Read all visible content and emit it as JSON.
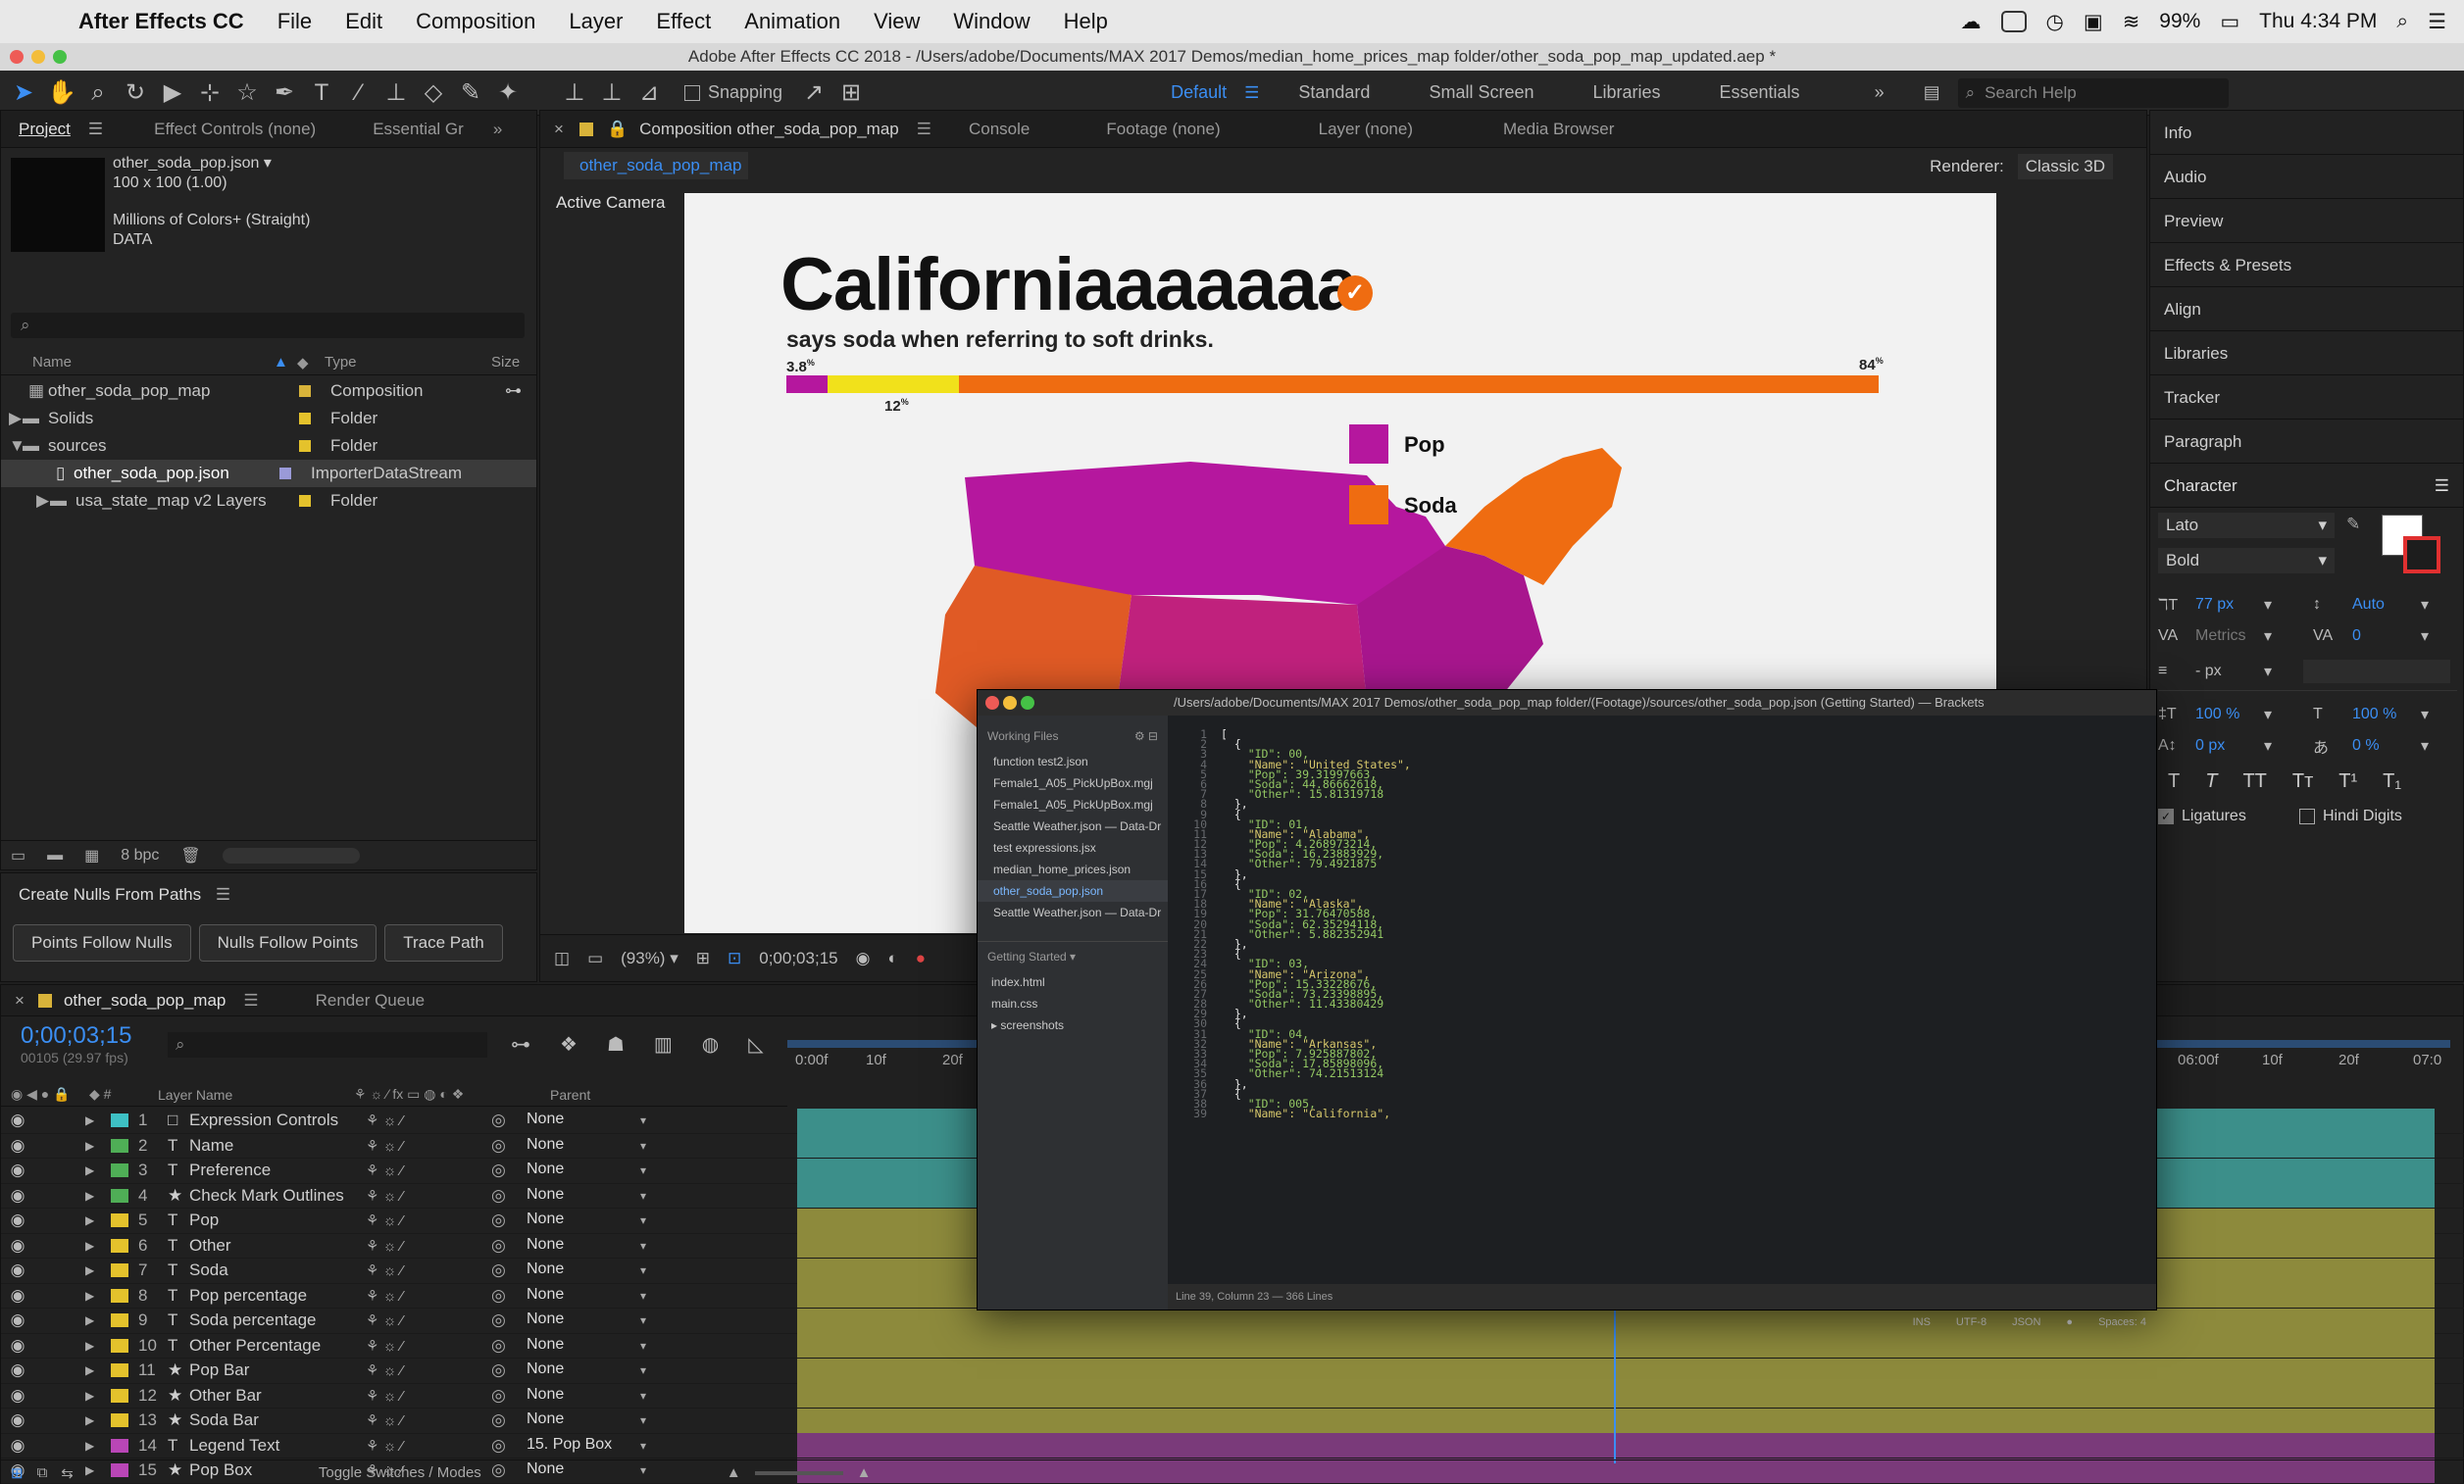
{
  "menubar": {
    "app": "After Effects CC",
    "items": [
      "File",
      "Edit",
      "Composition",
      "Layer",
      "Effect",
      "Animation",
      "View",
      "Window",
      "Help"
    ],
    "clock": "Thu 4:34 PM",
    "battery": "99%"
  },
  "window_title": "Adobe After Effects CC 2018 - /Users/adobe/Documents/MAX 2017 Demos/median_home_prices_map folder/other_soda_pop_map_updated.aep *",
  "toolbar": {
    "snapping": "Snapping",
    "workspaces": [
      "Default",
      "Standard",
      "Small Screen",
      "Libraries",
      "Essentials"
    ],
    "search_placeholder": "Search Help"
  },
  "project_panel": {
    "tabs": [
      "Project",
      "Effect Controls (none)",
      "Essential Gr"
    ],
    "selected_file": "other_soda_pop.json",
    "meta1": "100 x 100 (1.00)",
    "meta2": "Millions of Colors+ (Straight)",
    "meta3": "DATA",
    "col_name": "Name",
    "col_type": "Type",
    "col_size": "Size",
    "items": [
      {
        "name": "other_soda_pop_map",
        "type": "Composition",
        "color": "#d8b33a"
      },
      {
        "name": "Solids",
        "type": "Folder",
        "color": "#e4c22c"
      },
      {
        "name": "sources",
        "type": "Folder",
        "color": "#e4c22c"
      },
      {
        "name": "other_soda_pop.json",
        "type": "ImporterDataStream",
        "color": "#9a9ad8"
      },
      {
        "name": "usa_state_map v2 Layers",
        "type": "Folder",
        "color": "#e4c22c"
      }
    ],
    "bpc": "8 bpc"
  },
  "nulls_panel": {
    "title": "Create Nulls From Paths",
    "buttons": [
      "Points Follow Nulls",
      "Nulls Follow Points",
      "Trace Path"
    ]
  },
  "comp_panel": {
    "tabs": [
      "Composition other_soda_pop_map",
      "Console",
      "Footage (none)",
      "Layer (none)",
      "Media Browser"
    ],
    "comp_name": "other_soda_pop_map",
    "renderer_label": "Renderer:",
    "renderer": "Classic 3D",
    "active_camera": "Active Camera",
    "zoom": "(93%)",
    "timecode": "0;00;03;15"
  },
  "artboard": {
    "headline": "Californiaaaaaaa",
    "subhead": "says soda when referring to soft drinks.",
    "pct_pop": "3.8",
    "pct_other": "12",
    "pct_soda": "84",
    "legend": [
      "Pop",
      "Soda"
    ],
    "colors": {
      "pop": "#b5179e",
      "other": "#f1e11b",
      "soda": "#ef6c11"
    }
  },
  "brackets": {
    "title": "/Users/adobe/Documents/MAX 2017 Demos/other_soda_pop_map folder/(Footage)/sources/other_soda_pop.json (Getting Started) — Brackets",
    "working_files_label": "Working Files",
    "working_files": [
      "function test2.json",
      "Female1_A05_PickUpBox.mgj",
      "Female1_A05_PickUpBox.mgj",
      "Seattle Weather.json — Data-Dr",
      "test expressions.jsx",
      "median_home_prices.json",
      "other_soda_pop.json",
      "Seattle Weather.json — Data-Dr"
    ],
    "project_label": "Getting Started",
    "project_files": [
      "index.html",
      "main.css",
      "▸ screenshots"
    ],
    "status_left": "Line 39, Column 23 — 366 Lines",
    "status_right": [
      "INS",
      "UTF-8",
      "JSON",
      "Spaces: 4"
    ],
    "code": [
      {
        "n": "1",
        "t": "["
      },
      {
        "n": "2",
        "t": "  {"
      },
      {
        "n": "3",
        "t": "    \"ID\": 00,"
      },
      {
        "n": "4",
        "t": "    \"Name\": \"United States\","
      },
      {
        "n": "5",
        "t": "    \"Pop\": 39.31997663,"
      },
      {
        "n": "6",
        "t": "    \"Soda\": 44.86662618,"
      },
      {
        "n": "7",
        "t": "    \"Other\": 15.81319718"
      },
      {
        "n": "8",
        "t": "  },"
      },
      {
        "n": "9",
        "t": "  {"
      },
      {
        "n": "10",
        "t": "    \"ID\": 01,"
      },
      {
        "n": "11",
        "t": "    \"Name\": \"Alabama\","
      },
      {
        "n": "12",
        "t": "    \"Pop\": 4.268973214,"
      },
      {
        "n": "13",
        "t": "    \"Soda\": 16.23883929,"
      },
      {
        "n": "14",
        "t": "    \"Other\": 79.4921875"
      },
      {
        "n": "15",
        "t": "  },"
      },
      {
        "n": "16",
        "t": "  {"
      },
      {
        "n": "17",
        "t": "    \"ID\": 02,"
      },
      {
        "n": "18",
        "t": "    \"Name\": \"Alaska\","
      },
      {
        "n": "19",
        "t": "    \"Pop\": 31.76470588,"
      },
      {
        "n": "20",
        "t": "    \"Soda\": 62.35294118,"
      },
      {
        "n": "21",
        "t": "    \"Other\": 5.882352941"
      },
      {
        "n": "22",
        "t": "  },"
      },
      {
        "n": "23",
        "t": "  {"
      },
      {
        "n": "24",
        "t": "    \"ID\": 03,"
      },
      {
        "n": "25",
        "t": "    \"Name\": \"Arizona\","
      },
      {
        "n": "26",
        "t": "    \"Pop\": 15.33228676,"
      },
      {
        "n": "27",
        "t": "    \"Soda\": 73.23398895,"
      },
      {
        "n": "28",
        "t": "    \"Other\": 11.43380429"
      },
      {
        "n": "29",
        "t": "  },"
      },
      {
        "n": "30",
        "t": "  {"
      },
      {
        "n": "31",
        "t": "    \"ID\": 04,"
      },
      {
        "n": "32",
        "t": "    \"Name\": \"Arkansas\","
      },
      {
        "n": "33",
        "t": "    \"Pop\": 7.925887802,"
      },
      {
        "n": "34",
        "t": "    \"Soda\": 17.85898096,"
      },
      {
        "n": "35",
        "t": "    \"Other\": 74.21513124"
      },
      {
        "n": "36",
        "t": "  },"
      },
      {
        "n": "37",
        "t": "  {"
      },
      {
        "n": "38",
        "t": "    \"ID\": 005,"
      },
      {
        "n": "39",
        "t": "    \"Name\": \"California\","
      }
    ]
  },
  "right_panel": {
    "items": [
      "Info",
      "Audio",
      "Preview",
      "Effects & Presets",
      "Align",
      "Libraries",
      "Tracker",
      "Paragraph",
      "Character"
    ],
    "font": "Lato",
    "style": "Bold",
    "size": "77 px",
    "leading": "Auto",
    "kerning": "Metrics",
    "tracking": "0",
    "stroke": "- px",
    "vscale": "100 %",
    "hscale": "100 %",
    "baseline": "0 px",
    "tsume": "0 %",
    "ligatures": "Ligatures",
    "hindi": "Hindi Digits"
  },
  "timeline": {
    "tabs": [
      "other_soda_pop_map",
      "Render Queue"
    ],
    "timecode": "0;00;03;15",
    "frames": "00105 (29.97 fps)",
    "col_layer": "Layer Name",
    "col_parent": "Parent",
    "ruler": [
      "0:00f",
      "10f",
      "20f",
      "06:00f",
      "10f",
      "20f",
      "07:0"
    ],
    "toggle": "Toggle Switches / Modes",
    "layers": [
      {
        "n": "1",
        "icon": "□",
        "name": "Expression Controls",
        "parent": "None",
        "color": "#3ec0c4",
        "bar": "#3c8f8a"
      },
      {
        "n": "2",
        "icon": "T",
        "name": "Name",
        "parent": "None",
        "color": "#4fae56",
        "bar": "#3c8f8a"
      },
      {
        "n": "3",
        "icon": "T",
        "name": "Preference",
        "parent": "None",
        "color": "#4fae56",
        "bar": "#3c8f8a"
      },
      {
        "n": "4",
        "icon": "★",
        "name": "Check Mark Outlines",
        "parent": "None",
        "color": "#4fae56",
        "bar": "#3c8f8a"
      },
      {
        "n": "5",
        "icon": "T",
        "name": "Pop",
        "parent": "None",
        "color": "#e4c22c",
        "bar": "#8d8a3c"
      },
      {
        "n": "6",
        "icon": "T",
        "name": "Other",
        "parent": "None",
        "color": "#e4c22c",
        "bar": "#8d8a3c"
      },
      {
        "n": "7",
        "icon": "T",
        "name": "Soda",
        "parent": "None",
        "color": "#e4c22c",
        "bar": "#8d8a3c"
      },
      {
        "n": "8",
        "icon": "T",
        "name": "Pop percentage",
        "parent": "None",
        "color": "#e4c22c",
        "bar": "#8d8a3c"
      },
      {
        "n": "9",
        "icon": "T",
        "name": "Soda percentage",
        "parent": "None",
        "color": "#e4c22c",
        "bar": "#8d8a3c"
      },
      {
        "n": "10",
        "icon": "T",
        "name": "Other Percentage",
        "parent": "None",
        "color": "#e4c22c",
        "bar": "#8d8a3c"
      },
      {
        "n": "11",
        "icon": "★",
        "name": "Pop Bar",
        "parent": "None",
        "color": "#e4c22c",
        "bar": "#8d8a3c"
      },
      {
        "n": "12",
        "icon": "★",
        "name": "Other Bar",
        "parent": "None",
        "color": "#e4c22c",
        "bar": "#8d8a3c"
      },
      {
        "n": "13",
        "icon": "★",
        "name": "Soda Bar",
        "parent": "None",
        "color": "#e4c22c",
        "bar": "#8d8a3c"
      },
      {
        "n": "14",
        "icon": "T",
        "name": "Legend Text",
        "parent": "15. Pop Box",
        "color": "#b946b6",
        "bar": "#7a3a7a"
      },
      {
        "n": "15",
        "icon": "★",
        "name": "Pop Box",
        "parent": "None",
        "color": "#b946b6",
        "bar": "#7a3a7a"
      }
    ]
  }
}
